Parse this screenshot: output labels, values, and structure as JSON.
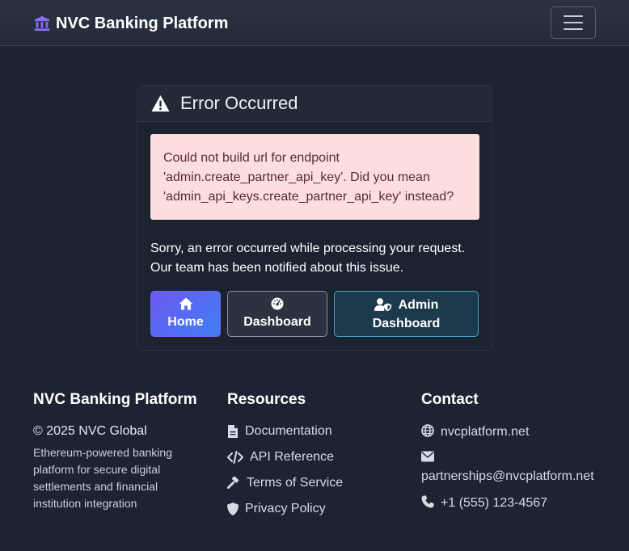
{
  "navbar": {
    "brand": "NVC Banking Platform",
    "brand_icon": "bank-icon",
    "toggle_icon": "hamburger-menu-icon"
  },
  "error_card": {
    "title": "Error Occurred",
    "title_icon": "warning-triangle-icon",
    "alert_text": "Could not build url for endpoint 'admin.create_partner_api_key'. Did you mean 'admin_api_keys.create_partner_api_key' instead?",
    "message": "Sorry, an error occurred while processing your request. Our team has been notified about this issue.",
    "buttons": {
      "home": "Home",
      "dashboard": "Dashboard",
      "admin_line1": "Admin",
      "admin_line2": "Dashboard"
    }
  },
  "footer": {
    "about": {
      "heading": "NVC Banking Platform",
      "copyright": "© 2025 NVC Global",
      "description": "Ethereum-powered banking platform for secure digital settlements and financial institution integration"
    },
    "resources": {
      "heading": "Resources",
      "links": [
        "Documentation",
        "API Reference",
        "Terms of Service",
        "Privacy Policy"
      ]
    },
    "contact": {
      "heading": "Contact",
      "website": "nvcplatform.net",
      "email": "partnerships@nvcplatform.net",
      "phone": "+1 (555) 123-4567"
    }
  },
  "colors": {
    "background": "#1c2333",
    "alert_bg": "#fddedf",
    "brand_icon": "#8b6cf6",
    "home_gradient_start": "#6d58f2",
    "home_gradient_end": "#3f7ef5",
    "admin_border": "#3fa7c2"
  }
}
